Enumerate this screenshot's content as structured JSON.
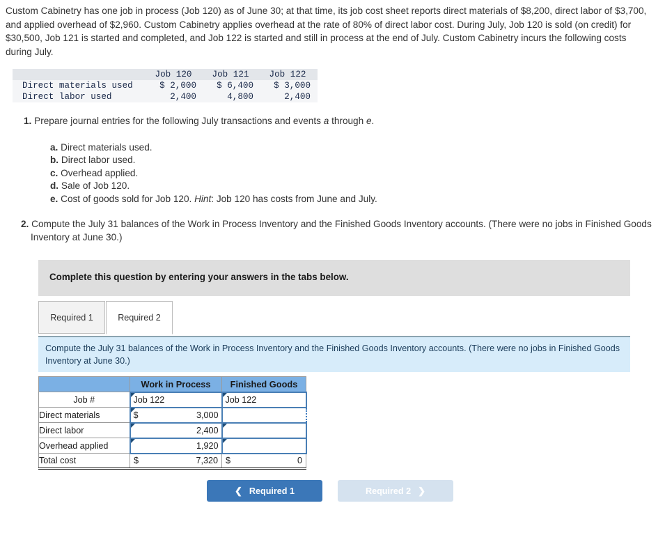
{
  "intro": "Custom Cabinetry has one job in process (Job 120) as of June 30; at that time, its job cost sheet reports direct materials of $8,200, direct labor of $3,700, and applied overhead of $2,960. Custom Cabinetry applies overhead at the rate of 80% of direct labor cost. During July, Job 120 is sold (on credit) for $30,500, Job 121 is started and completed, and Job 122 is started and still in process at the end of July. Custom Cabinetry incurs the following costs during July.",
  "costs_table": {
    "headers": [
      "",
      "Job 120",
      "Job 121",
      "Job 122"
    ],
    "rows": [
      {
        "label": "Direct materials used",
        "values": [
          "$ 2,000",
          "$ 6,400",
          "$ 3,000"
        ]
      },
      {
        "label": "Direct labor used",
        "values": [
          "2,400",
          "4,800",
          "2,400"
        ]
      }
    ]
  },
  "requirement_1": {
    "number": "1.",
    "text_before": "Prepare journal entries for the following July transactions and events",
    "emphasis_a": "a",
    "text_mid": "through",
    "emphasis_e": "e",
    "text_after": ".",
    "items": [
      {
        "letter": "a.",
        "text": "Direct materials used."
      },
      {
        "letter": "b.",
        "text": "Direct labor used."
      },
      {
        "letter": "c.",
        "text": "Overhead applied."
      },
      {
        "letter": "d.",
        "text": "Sale of Job 120."
      },
      {
        "letter": "e.",
        "text": "Cost of goods sold for Job 120.",
        "hint_label": "Hint",
        "hint_text": ": Job 120 has costs from June and July."
      }
    ]
  },
  "requirement_2": {
    "number": "2.",
    "text": "Compute the July 31 balances of the Work in Process Inventory and the Finished Goods Inventory accounts. (There were no jobs in Finished Goods Inventory at June 30.)"
  },
  "banner": {
    "text": "Complete this question by entering your answers in the tabs below."
  },
  "tabs": [
    {
      "label": "Required 1",
      "active": false
    },
    {
      "label": "Required 2",
      "active": true
    }
  ],
  "instruction_panel": {
    "text": "Compute the July 31 balances of the Work in Process Inventory and the Finished Goods Inventory accounts. (There were no jobs in Finished Goods Inventory at June 30.)"
  },
  "answer_grid": {
    "headers": [
      "",
      "Work in Process",
      "Finished Goods"
    ],
    "rows": [
      {
        "label": "Job #",
        "label_align": "center",
        "wip": {
          "type": "text",
          "value": "Job 122",
          "marker": true
        },
        "fg": {
          "type": "text",
          "value": "Job 122",
          "marker": true
        }
      },
      {
        "label": "Direct materials",
        "label_align": "left",
        "wip": {
          "type": "money",
          "currency": "$",
          "value": "3,000",
          "marker": true
        },
        "fg": {
          "type": "empty",
          "value": "",
          "marker": false,
          "selected": true
        }
      },
      {
        "label": "Direct labor",
        "label_align": "left",
        "wip": {
          "type": "number",
          "value": "2,400",
          "marker": true
        },
        "fg": {
          "type": "empty",
          "value": "",
          "marker": true
        }
      },
      {
        "label": "Overhead applied",
        "label_align": "left",
        "wip": {
          "type": "number",
          "value": "1,920",
          "marker": true
        },
        "fg": {
          "type": "empty",
          "value": "",
          "marker": true
        }
      }
    ],
    "total_row": {
      "label": "Total cost",
      "wip_currency": "$",
      "wip_value": "7,320",
      "fg_currency": "$",
      "fg_value": "0"
    }
  },
  "nav": {
    "prev_label": "Required 1",
    "prev_icon": "chevron-left",
    "next_label": "Required 2",
    "next_icon": "chevron-right"
  },
  "colors": {
    "header_blue": "#7bb0e4",
    "panel_blue": "#d7ecfa",
    "banner_gray": "#dedede",
    "primary_button": "#3b77b8",
    "disabled_button": "#d5e2ef",
    "input_border": "#4a7fb5"
  }
}
